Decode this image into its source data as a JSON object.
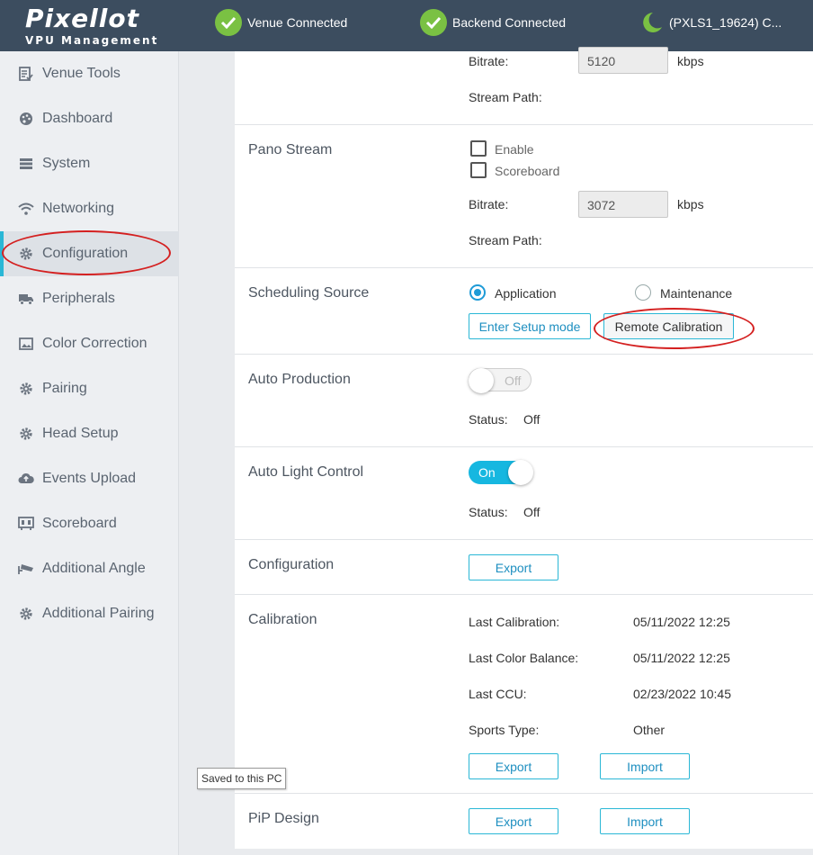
{
  "header": {
    "logo": "Pixellot",
    "logo_sub": "VPU Management",
    "venue_status": "Venue Connected",
    "backend_status": "Backend Connected",
    "device": "(PXLS1_19624) C..."
  },
  "sidebar": {
    "items": [
      {
        "label": "Venue Tools",
        "icon": "checklist-icon"
      },
      {
        "label": "Dashboard",
        "icon": "palette-icon"
      },
      {
        "label": "System",
        "icon": "server-icon"
      },
      {
        "label": "Networking",
        "icon": "wifi-icon"
      },
      {
        "label": "Configuration",
        "icon": "gear-icon",
        "active": true
      },
      {
        "label": "Peripherals",
        "icon": "truck-icon"
      },
      {
        "label": "Color Correction",
        "icon": "image-icon"
      },
      {
        "label": "Pairing",
        "icon": "gear-icon"
      },
      {
        "label": "Head Setup",
        "icon": "gear-icon"
      },
      {
        "label": "Events Upload",
        "icon": "cloud-upload-icon"
      },
      {
        "label": "Scoreboard",
        "icon": "scoreboard-icon"
      },
      {
        "label": "Additional Angle",
        "icon": "cctv-icon"
      },
      {
        "label": "Additional Pairing",
        "icon": "gear-icon"
      }
    ]
  },
  "tooltip": "Saved to this PC",
  "stream_top": {
    "bitrate_label": "Bitrate:",
    "bitrate_value": "5120",
    "unit": "kbps",
    "path_label": "Stream Path:"
  },
  "pano": {
    "title": "Pano Stream",
    "enable_label": "Enable",
    "scoreboard_label": "Scoreboard",
    "bitrate_label": "Bitrate:",
    "bitrate_value": "3072",
    "unit": "kbps",
    "path_label": "Stream Path:"
  },
  "scheduling": {
    "title": "Scheduling Source",
    "option_application": "Application",
    "option_maintenance": "Maintenance",
    "selected": "Application",
    "setup_button": "Enter Setup mode",
    "calibration_button": "Remote Calibration"
  },
  "auto_production": {
    "title": "Auto Production",
    "toggle_text": "Off",
    "status_label": "Status:",
    "status_value": "Off"
  },
  "auto_light": {
    "title": "Auto Light Control",
    "toggle_text": "On",
    "status_label": "Status:",
    "status_value": "Off"
  },
  "configuration": {
    "title": "Configuration",
    "export_button": "Export"
  },
  "calibration": {
    "title": "Calibration",
    "last_calibration_label": "Last Calibration:",
    "last_calibration_value": "05/11/2022 12:25",
    "last_color_label": "Last Color Balance:",
    "last_color_value": "05/11/2022 12:25",
    "last_ccu_label": "Last CCU:",
    "last_ccu_value": "02/23/2022 10:45",
    "sports_label": "Sports Type:",
    "sports_value": "Other",
    "export_button": "Export",
    "import_button": "Import"
  },
  "pip": {
    "title": "PiP Design",
    "export_button": "Export",
    "import_button": "Import"
  },
  "colors": {
    "header_bg": "#3c4d5f",
    "accent": "#2ab7d6",
    "status_green": "#7ac143",
    "annotation_red": "#d42020"
  }
}
